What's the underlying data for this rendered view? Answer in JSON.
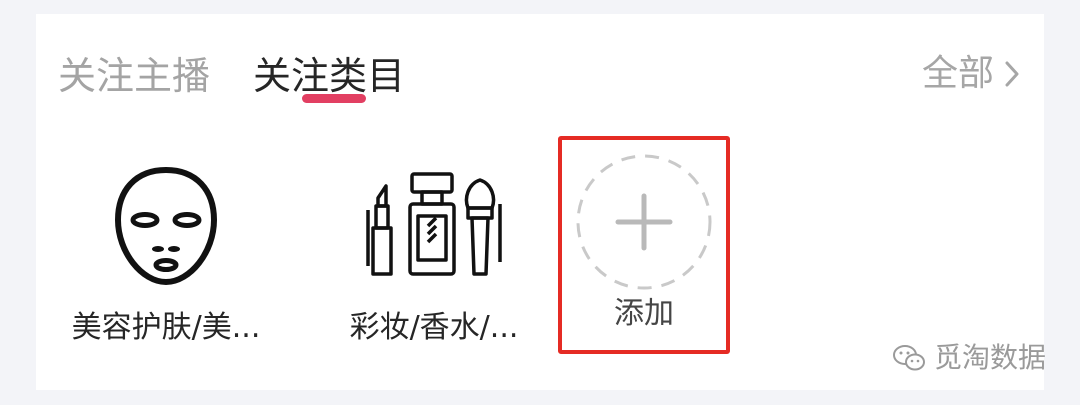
{
  "tabs": {
    "items": [
      {
        "label": "关注主播",
        "active": false
      },
      {
        "label": "关注类目",
        "active": true
      }
    ],
    "accent_color": "#e23f62"
  },
  "header": {
    "all_label": "全部",
    "all_icon": "chevron-right-icon"
  },
  "categories": [
    {
      "label": "美容护肤/美...",
      "icon": "face-mask-icon"
    },
    {
      "label": "彩妆/香水/...",
      "icon": "cosmetics-icon"
    }
  ],
  "add": {
    "label": "添加",
    "icon": "plus-icon",
    "highlight_color": "#e52b24"
  },
  "watermark": {
    "label": "觅淘数据",
    "icon": "wechat-icon"
  }
}
